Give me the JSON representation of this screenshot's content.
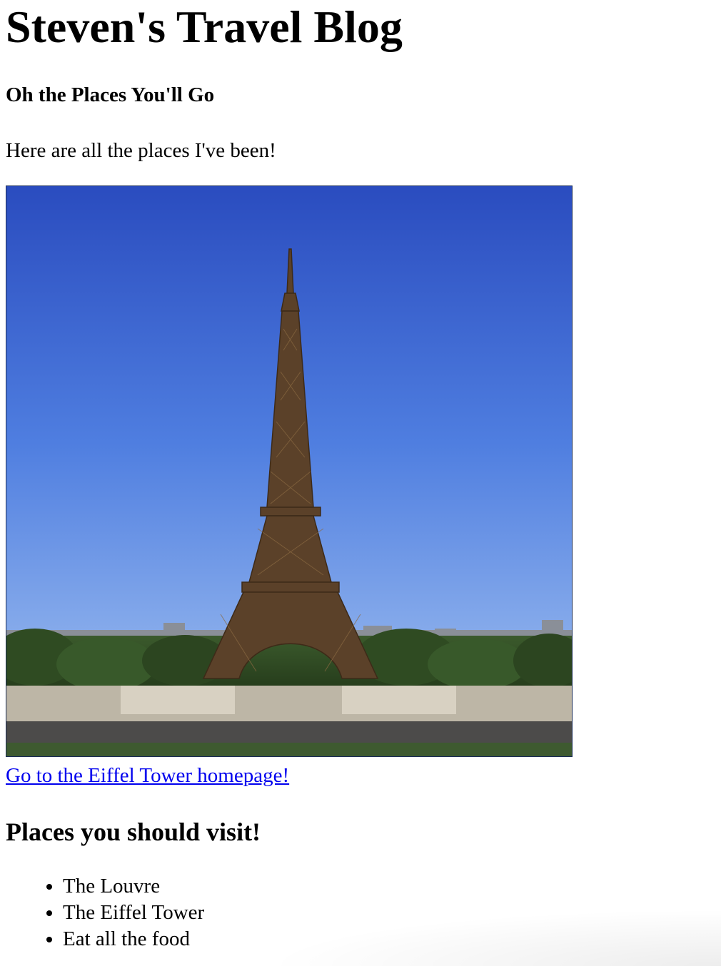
{
  "page": {
    "title": "Steven's Travel Blog",
    "subtitle": "Oh the Places You'll Go",
    "intro": "Here are all the places I've been!"
  },
  "photo": {
    "subject": "eiffel-tower-photo",
    "colors": {
      "sky_top": "#2a4fc0",
      "sky_bottom": "#9ec0f0",
      "tower": "#5a4028",
      "trees": "#2e4a22",
      "plaza": "#cfc7b8"
    }
  },
  "link": {
    "label": "Go to the Eiffel Tower homepage!",
    "color": "#0000ee"
  },
  "section": {
    "heading": "Places you should visit!",
    "items": [
      "The Louvre",
      "The Eiffel Tower",
      "Eat all the food"
    ]
  }
}
